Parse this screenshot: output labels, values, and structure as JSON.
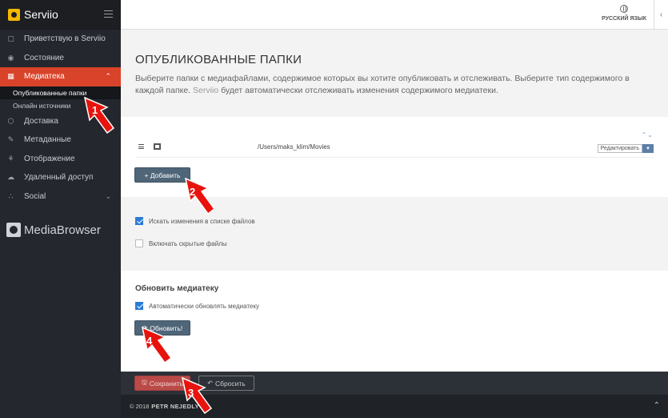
{
  "brand": {
    "name": "Serviio"
  },
  "sidebar": {
    "items": [
      {
        "label": "Приветствую в Serviio",
        "icon": "home-icon"
      },
      {
        "label": "Состояние",
        "icon": "status-icon"
      },
      {
        "label": "Медиатека",
        "icon": "library-icon",
        "active": true
      },
      {
        "label": "Доставка",
        "icon": "delivery-icon"
      },
      {
        "label": "Метаданные",
        "icon": "metadata-icon"
      },
      {
        "label": "Отображение",
        "icon": "display-icon"
      },
      {
        "label": "Удаленный доступ",
        "icon": "cloud-icon"
      },
      {
        "label": "Social",
        "icon": "share-icon"
      }
    ],
    "library_sub": [
      {
        "label": "Опубликованные папки",
        "current": true
      },
      {
        "label": "Онлайн источники"
      }
    ],
    "mediabrowser": "MediaBrowser"
  },
  "topbar": {
    "language": "РУССКИЙ ЯЗЫК"
  },
  "page": {
    "title": "ОПУБЛИКОВАННЫЕ ПАПКИ",
    "desc_part1": "Выберите папки с медиафайлами, содержимое которых вы хотите опубликовать и отслеживать. Выберите тип содержимого в каждой папке. ",
    "desc_brand": "Serviio",
    "desc_part2": " будет автоматически отслеживать изменения содержимого медиатеки."
  },
  "folders": {
    "rows": [
      {
        "path": "/Users/maks_klim/Movies",
        "edit_label": "Редактировать"
      }
    ],
    "add_label": "+ Добавить"
  },
  "options": {
    "watch_changes": {
      "label": "Искать изменения в списке файлов",
      "checked": true
    },
    "hidden_files": {
      "label": "Включать скрытые файлы",
      "checked": false
    }
  },
  "refresh": {
    "title": "Обновить медиатеку",
    "auto_label": "Автоматически обновлять медиатеку",
    "auto_checked": true,
    "button_label": "Обновить!"
  },
  "actions": {
    "save_label": "Сохранить",
    "reset_label": "Сбросить"
  },
  "footer": {
    "copyright": "© 2018",
    "author": "PETR NEJEDLY"
  },
  "markers": [
    "1",
    "2",
    "3",
    "4"
  ],
  "colors": {
    "accent": "#d9432a",
    "sidebar": "#24272d",
    "button": "#4f6578",
    "checkbox": "#2b7bd6"
  }
}
